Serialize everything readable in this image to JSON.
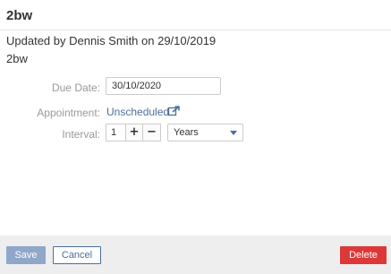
{
  "header": {
    "title": "2bw"
  },
  "meta": {
    "updated_text": "Updated by Dennis Smith on 29/10/2019",
    "description": "2bw"
  },
  "form": {
    "due_date": {
      "label": "Due Date:",
      "value": "30/10/2020"
    },
    "appointment": {
      "label": "Appointment:",
      "value": "Unscheduled",
      "icon": "external-link-icon"
    },
    "interval": {
      "label": "Interval:",
      "value": "1",
      "plus_label": "+",
      "minus_label": "−",
      "unit": "Years",
      "unit_icon": "chevron-down-icon"
    }
  },
  "footer": {
    "save_label": "Save",
    "cancel_label": "Cancel",
    "delete_label": "Delete"
  },
  "colors": {
    "link": "#4a6f9c",
    "save_bg": "#8fa7c9",
    "delete_bg": "#dc3838",
    "footer_bg": "#eeeeee"
  }
}
